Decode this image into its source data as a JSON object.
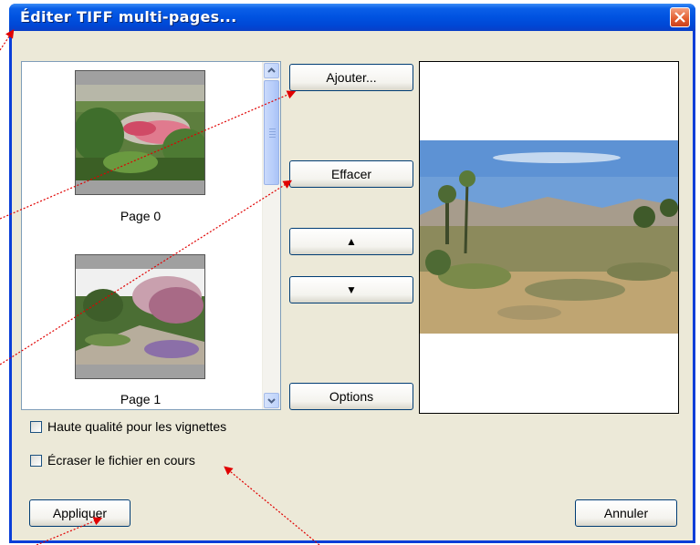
{
  "window": {
    "title": "Éditer TIFF multi-pages..."
  },
  "thumbnails": [
    {
      "label": "Page 0"
    },
    {
      "label": "Page 1"
    }
  ],
  "buttons": {
    "add": "Ajouter...",
    "delete": "Effacer",
    "move_up": "▲",
    "move_down": "▼",
    "options": "Options",
    "apply": "Appliquer",
    "cancel": "Annuler"
  },
  "checkboxes": {
    "high_quality": {
      "label": "Haute qualité pour les vignettes",
      "checked": false
    },
    "overwrite": {
      "label": "Écraser le fichier en cours",
      "checked": false
    }
  },
  "icons": [
    "close-icon",
    "scroll-up-icon",
    "scroll-down-icon",
    "arrow-up-icon",
    "arrow-down-icon"
  ],
  "colors": {
    "titlebar": "#0052e0",
    "dialog_bg": "#ece9d8",
    "annotation": "#e00000"
  }
}
